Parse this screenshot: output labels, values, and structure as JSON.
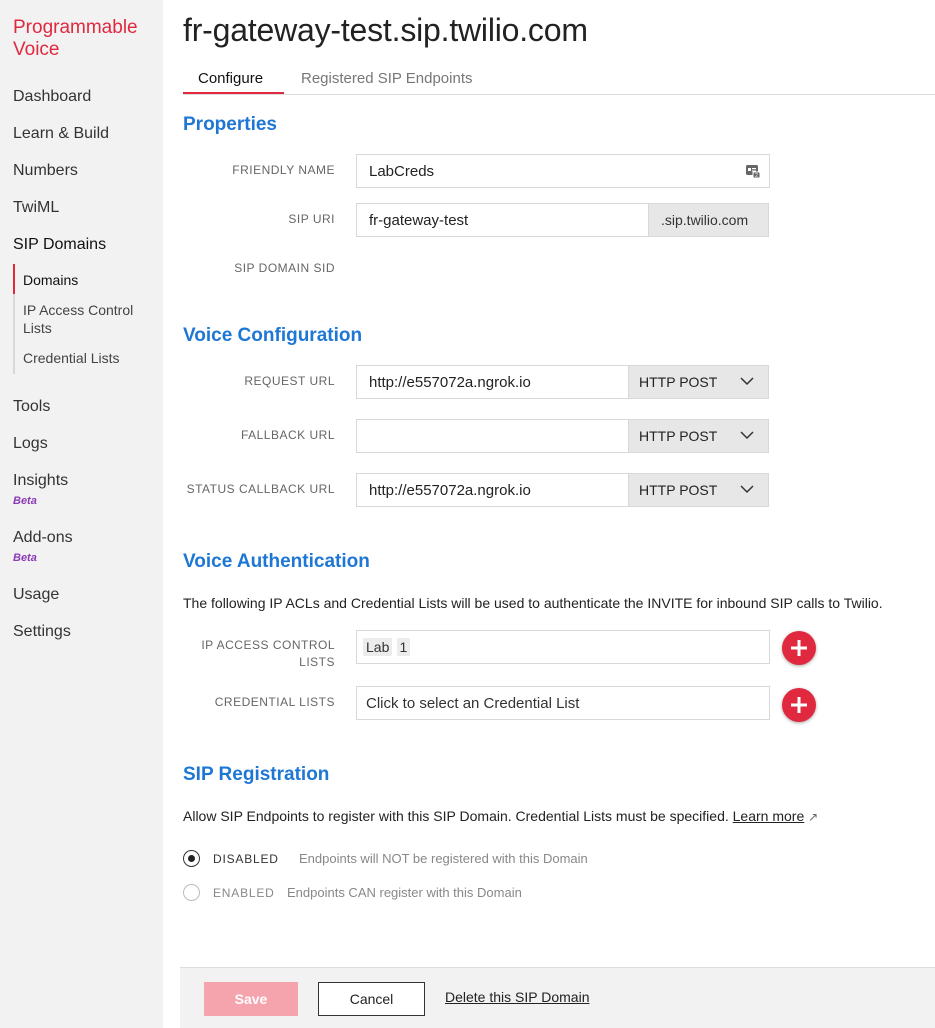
{
  "sidebar": {
    "brand": "Programmable Voice",
    "items": [
      {
        "label": "Dashboard"
      },
      {
        "label": "Learn & Build"
      },
      {
        "label": "Numbers"
      },
      {
        "label": "TwiML"
      },
      {
        "label": "SIP Domains"
      },
      {
        "label": "Tools"
      },
      {
        "label": "Logs"
      },
      {
        "label": "Insights",
        "badge": "Beta"
      },
      {
        "label": "Add-ons",
        "badge": "Beta"
      },
      {
        "label": "Usage"
      },
      {
        "label": "Settings"
      }
    ],
    "sub_items": [
      {
        "label": "Domains"
      },
      {
        "label": "IP Access Control Lists"
      },
      {
        "label": "Credential Lists"
      }
    ]
  },
  "page": {
    "title": "fr-gateway-test.sip.twilio.com",
    "tabs": [
      {
        "label": "Configure"
      },
      {
        "label": "Registered SIP Endpoints"
      }
    ]
  },
  "properties": {
    "title": "Properties",
    "friendly_name_label": "FRIENDLY NAME",
    "friendly_name_value": "LabCreds",
    "sip_uri_label": "SIP URI",
    "sip_uri_value": "fr-gateway-test",
    "sip_uri_suffix": ".sip.twilio.com",
    "sip_domain_sid_label": "SIP DOMAIN SID"
  },
  "voice_config": {
    "title": "Voice Configuration",
    "request_url_label": "REQUEST URL",
    "request_url_value": "http://e557072a.ngrok.io",
    "request_method": "HTTP POST",
    "fallback_url_label": "FALLBACK URL",
    "fallback_url_value": "",
    "fallback_method": "HTTP POST",
    "status_callback_label": "STATUS CALLBACK URL",
    "status_callback_value": "http://e557072a.ngrok.io",
    "status_callback_method": "HTTP POST"
  },
  "voice_auth": {
    "title": "Voice Authentication",
    "description": "The following IP ACLs and Credential Lists will be used to authenticate the INVITE for inbound SIP calls to Twilio.",
    "ip_acl_label_1": "IP ACCESS CONTROL",
    "ip_acl_label_2": "LISTS",
    "ip_acl_chip_1": "Lab",
    "ip_acl_chip_2": "1",
    "credential_lists_label": "CREDENTIAL LISTS",
    "credential_lists_placeholder": "Click to select an Credential List"
  },
  "sip_registration": {
    "title": "SIP Registration",
    "description": "Allow SIP Endpoints to register with this SIP Domain. Credential Lists must be specified.",
    "learn_more": "Learn more",
    "learn_more_arrow": "↗",
    "options": [
      {
        "label": "DISABLED",
        "desc": "Endpoints will NOT be registered with this Domain",
        "checked": true
      },
      {
        "label": "ENABLED",
        "desc": "Endpoints CAN register with this Domain",
        "checked": false
      }
    ]
  },
  "footer": {
    "save": "Save",
    "cancel": "Cancel",
    "delete": "Delete this SIP Domain"
  },
  "colors": {
    "brand": "#e0283f",
    "section_title": "#1e77d4",
    "beta": "#8b3bb8",
    "save_disabled": "#f5a3ad"
  },
  "icons": {
    "friendly_name_field": "contact-card-icon",
    "select": "chevron-down-icon",
    "add": "plus-circle-icon",
    "external_link": "external-link-icon"
  }
}
